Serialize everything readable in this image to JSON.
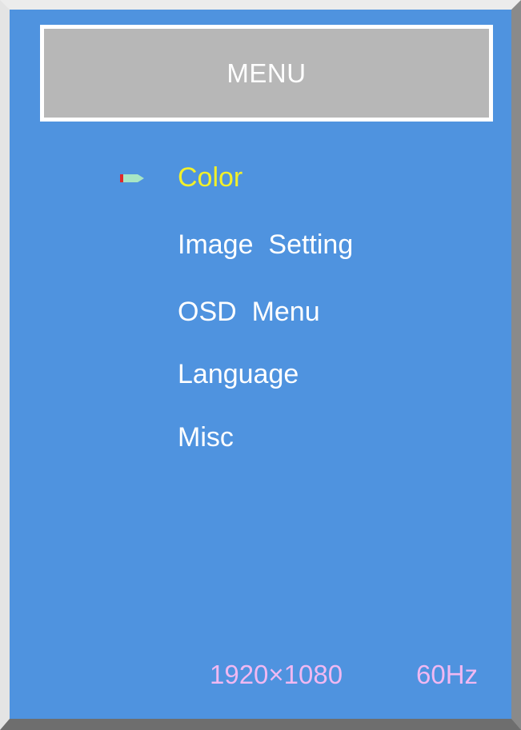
{
  "osd": {
    "title": "MENU",
    "menu_items": [
      {
        "label": "Color",
        "selected": true
      },
      {
        "label": "Image  Setting",
        "selected": false
      },
      {
        "label": "OSD  Menu",
        "selected": false
      },
      {
        "label": "Language",
        "selected": false
      },
      {
        "label": "Misc",
        "selected": false
      }
    ],
    "cursor_icon": "pointer-arrow-icon",
    "status": {
      "resolution": "1920×1080",
      "refresh_rate": "60Hz"
    }
  },
  "colors": {
    "background": "#4f93df",
    "title_bar": "#b7b7b7",
    "selected_text": "#f2f02a",
    "menu_text": "#ffffff",
    "status_text": "#f0b8f2"
  }
}
